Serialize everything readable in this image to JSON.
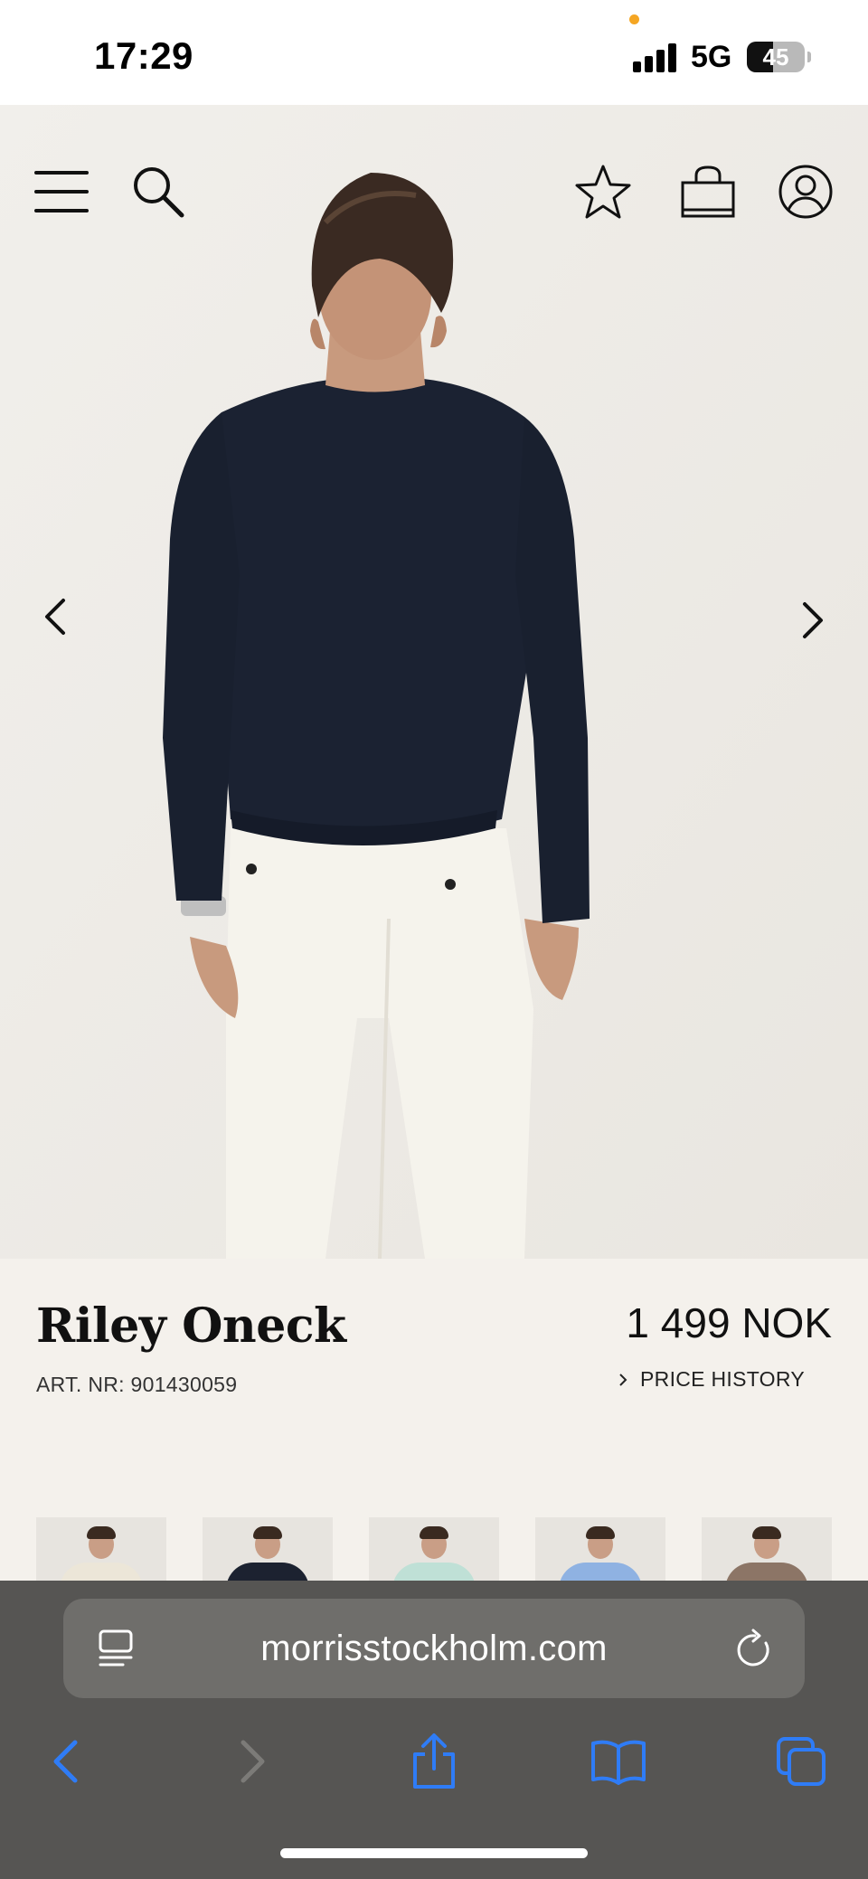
{
  "status_bar": {
    "time": "17:29",
    "network": "5G",
    "battery_percent": "45",
    "battery_level": 0.45
  },
  "header": {
    "icons": [
      "menu-icon",
      "search-icon",
      "star-icon",
      "bag-icon",
      "account-icon"
    ]
  },
  "gallery": {
    "prev_icon": "chevron-left-icon",
    "next_icon": "chevron-right-icon"
  },
  "product": {
    "name": "Riley Oneck",
    "art_nr": "ART. NR: 901430059",
    "price": "1 499 NOK",
    "price_history_label": "PRICE HISTORY"
  },
  "variants": [
    {
      "color": "#ece6d8"
    },
    {
      "color": "#1c2230"
    },
    {
      "color": "#bfe0d6"
    },
    {
      "color": "#8fb2e2"
    },
    {
      "color": "#8c7566"
    }
  ],
  "browser": {
    "url": "morrisstockholm.com",
    "accent_color": "#2f7cf6",
    "toolbar_icons": [
      "back-icon",
      "forward-icon",
      "share-icon",
      "bookmarks-icon",
      "tabs-icon"
    ]
  }
}
